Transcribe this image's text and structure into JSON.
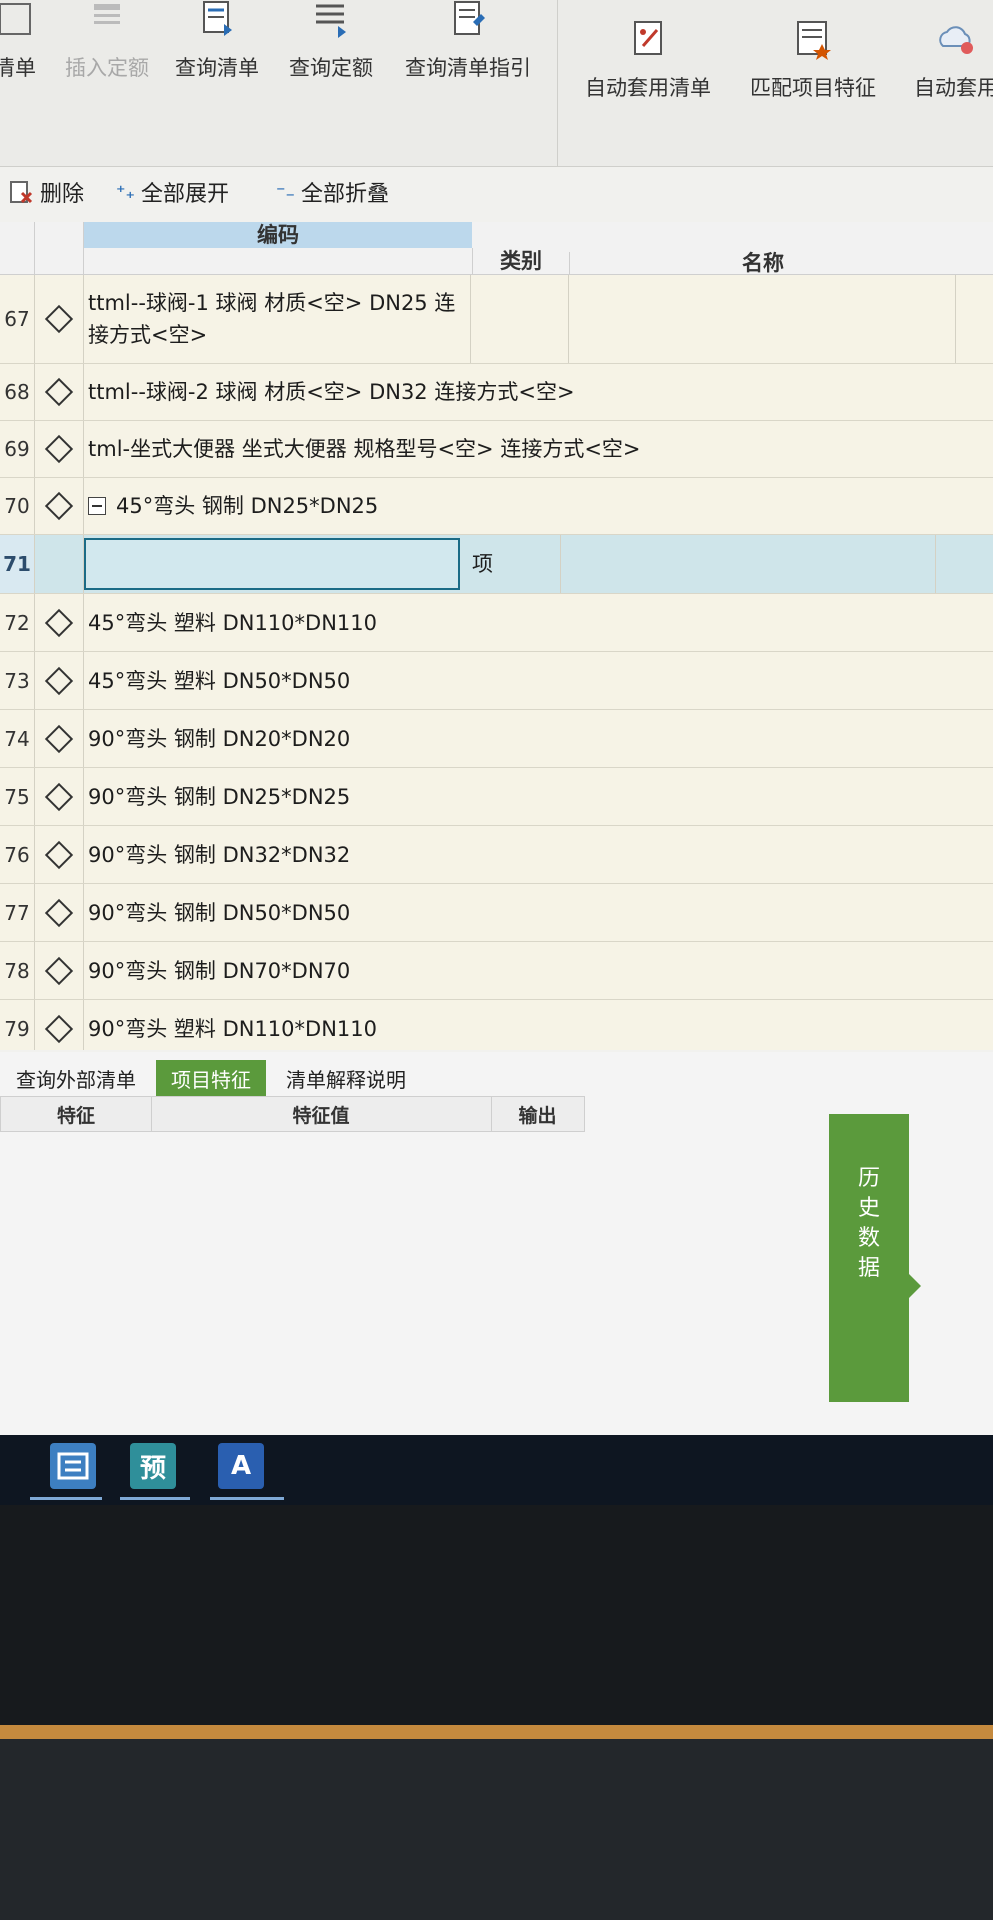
{
  "ribbon": {
    "buttons": [
      {
        "label": "清单",
        "icon": "list-icon",
        "disabled": false
      },
      {
        "label": "插入定额",
        "icon": "insert-norm-icon",
        "disabled": true
      },
      {
        "label": "查询清单",
        "icon": "query-list-icon",
        "disabled": false
      },
      {
        "label": "查询定额",
        "icon": "query-norm-icon",
        "disabled": false
      },
      {
        "label": "查询清单指引",
        "icon": "query-guide-icon",
        "disabled": false
      },
      {
        "label": "自动套用清单",
        "icon": "auto-apply-list-icon",
        "disabled": false
      },
      {
        "label": "匹配项目特征",
        "icon": "match-feature-icon",
        "disabled": false
      },
      {
        "label": "自动套用",
        "icon": "auto-apply-icon",
        "disabled": false
      }
    ]
  },
  "toolbar": {
    "delete_label": "删除",
    "expand_all_label": "全部展开",
    "collapse_all_label": "全部折叠"
  },
  "grid": {
    "columns": {
      "code": "编码",
      "type": "类别",
      "name": "名称"
    },
    "rows": [
      {
        "num": "67",
        "text": "ttml--球阀-1 球阀 材质<空> DN25 连接方式<空>"
      },
      {
        "num": "68",
        "text": "ttml--球阀-2 球阀 材质<空> DN32 连接方式<空>"
      },
      {
        "num": "69",
        "text": "tml-坐式大便器 坐式大便器 规格型号<空> 连接方式<空>"
      },
      {
        "num": "70",
        "text": "45°弯头 钢制 DN25*DN25"
      },
      {
        "num": "71",
        "text": "",
        "type": "项"
      },
      {
        "num": "72",
        "text": "45°弯头 塑料 DN110*DN110"
      },
      {
        "num": "73",
        "text": "45°弯头 塑料 DN50*DN50"
      },
      {
        "num": "74",
        "text": "90°弯头 钢制 DN20*DN20"
      },
      {
        "num": "75",
        "text": "90°弯头 钢制 DN25*DN25"
      },
      {
        "num": "76",
        "text": "90°弯头 钢制 DN32*DN32"
      },
      {
        "num": "77",
        "text": "90°弯头 钢制 DN50*DN50"
      },
      {
        "num": "78",
        "text": "90°弯头 钢制 DN70*DN70"
      },
      {
        "num": "79",
        "text": "90°弯头 塑料 DN110*DN110"
      }
    ]
  },
  "bottom": {
    "tabs": [
      {
        "label": "查询外部清单",
        "active": false
      },
      {
        "label": "项目特征",
        "active": true
      },
      {
        "label": "清单解释说明",
        "active": false
      }
    ],
    "columns": {
      "feature": "特征",
      "feature_value": "特征值",
      "output": "输出"
    },
    "history_label": [
      "历",
      "史",
      "数",
      "据"
    ]
  },
  "taskbar": {
    "apps": [
      {
        "glyph": "",
        "icon": "app-calc-icon"
      },
      {
        "glyph": "预",
        "icon": "app-budget-icon"
      },
      {
        "glyph": "A",
        "icon": "app-a-icon"
      }
    ]
  },
  "colors": {
    "accent_green": "#5b9a3c",
    "selected_row": "#cfe5ea",
    "row_bg": "#f6f3e6"
  }
}
